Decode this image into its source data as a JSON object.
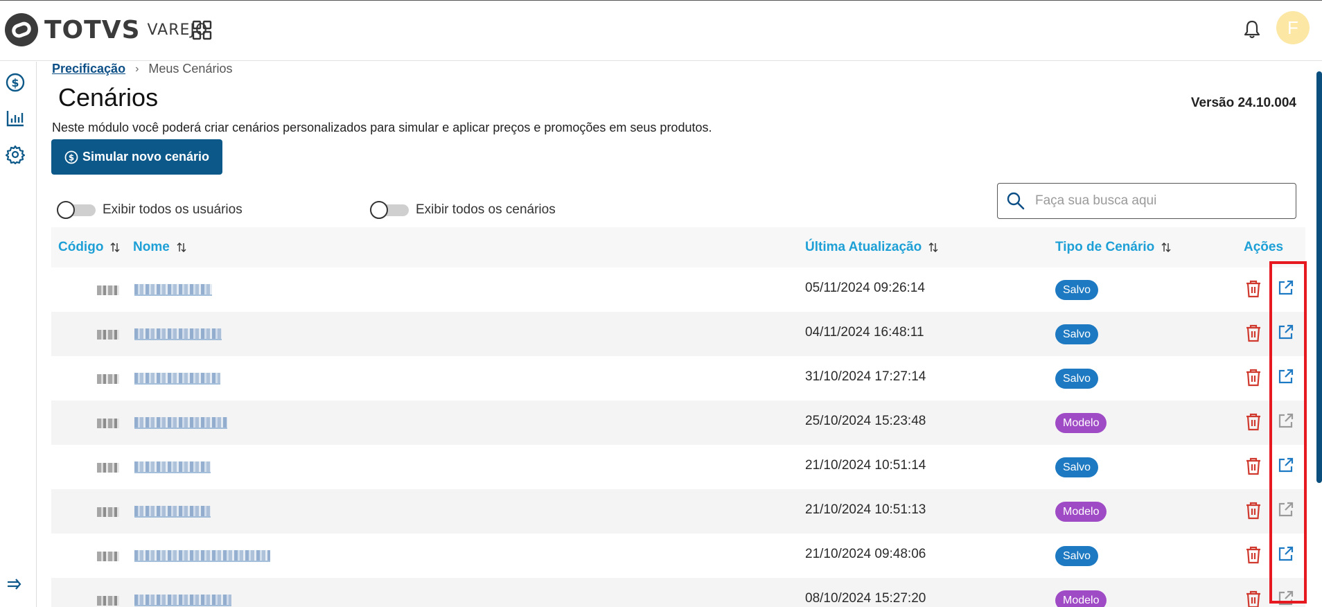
{
  "header": {
    "logo_text": "TOTVS",
    "logo_sub": "VAREJO",
    "avatar_initial": "F"
  },
  "icons": {
    "apps": "apps-grid-icon",
    "bell": "bell-icon",
    "pricing": "dollar-circle-icon",
    "reports": "bar-chart-icon",
    "settings": "gear-icon",
    "collapse": "expand-menu-icon",
    "search": "search-icon",
    "sort": "sort-arrows-icon",
    "delete": "trash-icon",
    "open": "external-link-icon"
  },
  "breadcrumb": {
    "root": "Precificação",
    "current": "Meus Cenários"
  },
  "page": {
    "title": "Cenários",
    "version": "Versão 24.10.004",
    "description": "Neste módulo você poderá criar cenários personalizados para simular e aplicar preços e promoções em seus produtos.",
    "new_button": "Simular novo cenário"
  },
  "filters": {
    "all_users": "Exibir todos os usuários",
    "all_scenarios": "Exibir todos os cenários"
  },
  "search": {
    "placeholder": "Faça sua busca aqui"
  },
  "table": {
    "columns": {
      "code": "Código",
      "name": "Nome",
      "updated": "Última Atualização",
      "type": "Tipo de Cenário",
      "actions": "Ações"
    },
    "rows": [
      {
        "updated": "05/11/2024 09:26:14",
        "type": "Salvo"
      },
      {
        "updated": "04/11/2024 16:48:11",
        "type": "Salvo"
      },
      {
        "updated": "31/10/2024 17:27:14",
        "type": "Salvo"
      },
      {
        "updated": "25/10/2024 15:23:48",
        "type": "Modelo"
      },
      {
        "updated": "21/10/2024 10:51:14",
        "type": "Salvo"
      },
      {
        "updated": "21/10/2024 10:51:13",
        "type": "Modelo"
      },
      {
        "updated": "21/10/2024 09:48:06",
        "type": "Salvo"
      },
      {
        "updated": "08/10/2024 15:27:20",
        "type": "Modelo"
      }
    ]
  },
  "colors": {
    "primary": "#0c5889",
    "header_link": "#1ea0d6",
    "badge_salvo": "#1d79c1",
    "badge_modelo": "#a04bc6",
    "delete": "#d0392e",
    "open_enabled": "#1d79c1",
    "open_disabled": "#9a9a9a",
    "highlight": "#e5191f"
  }
}
